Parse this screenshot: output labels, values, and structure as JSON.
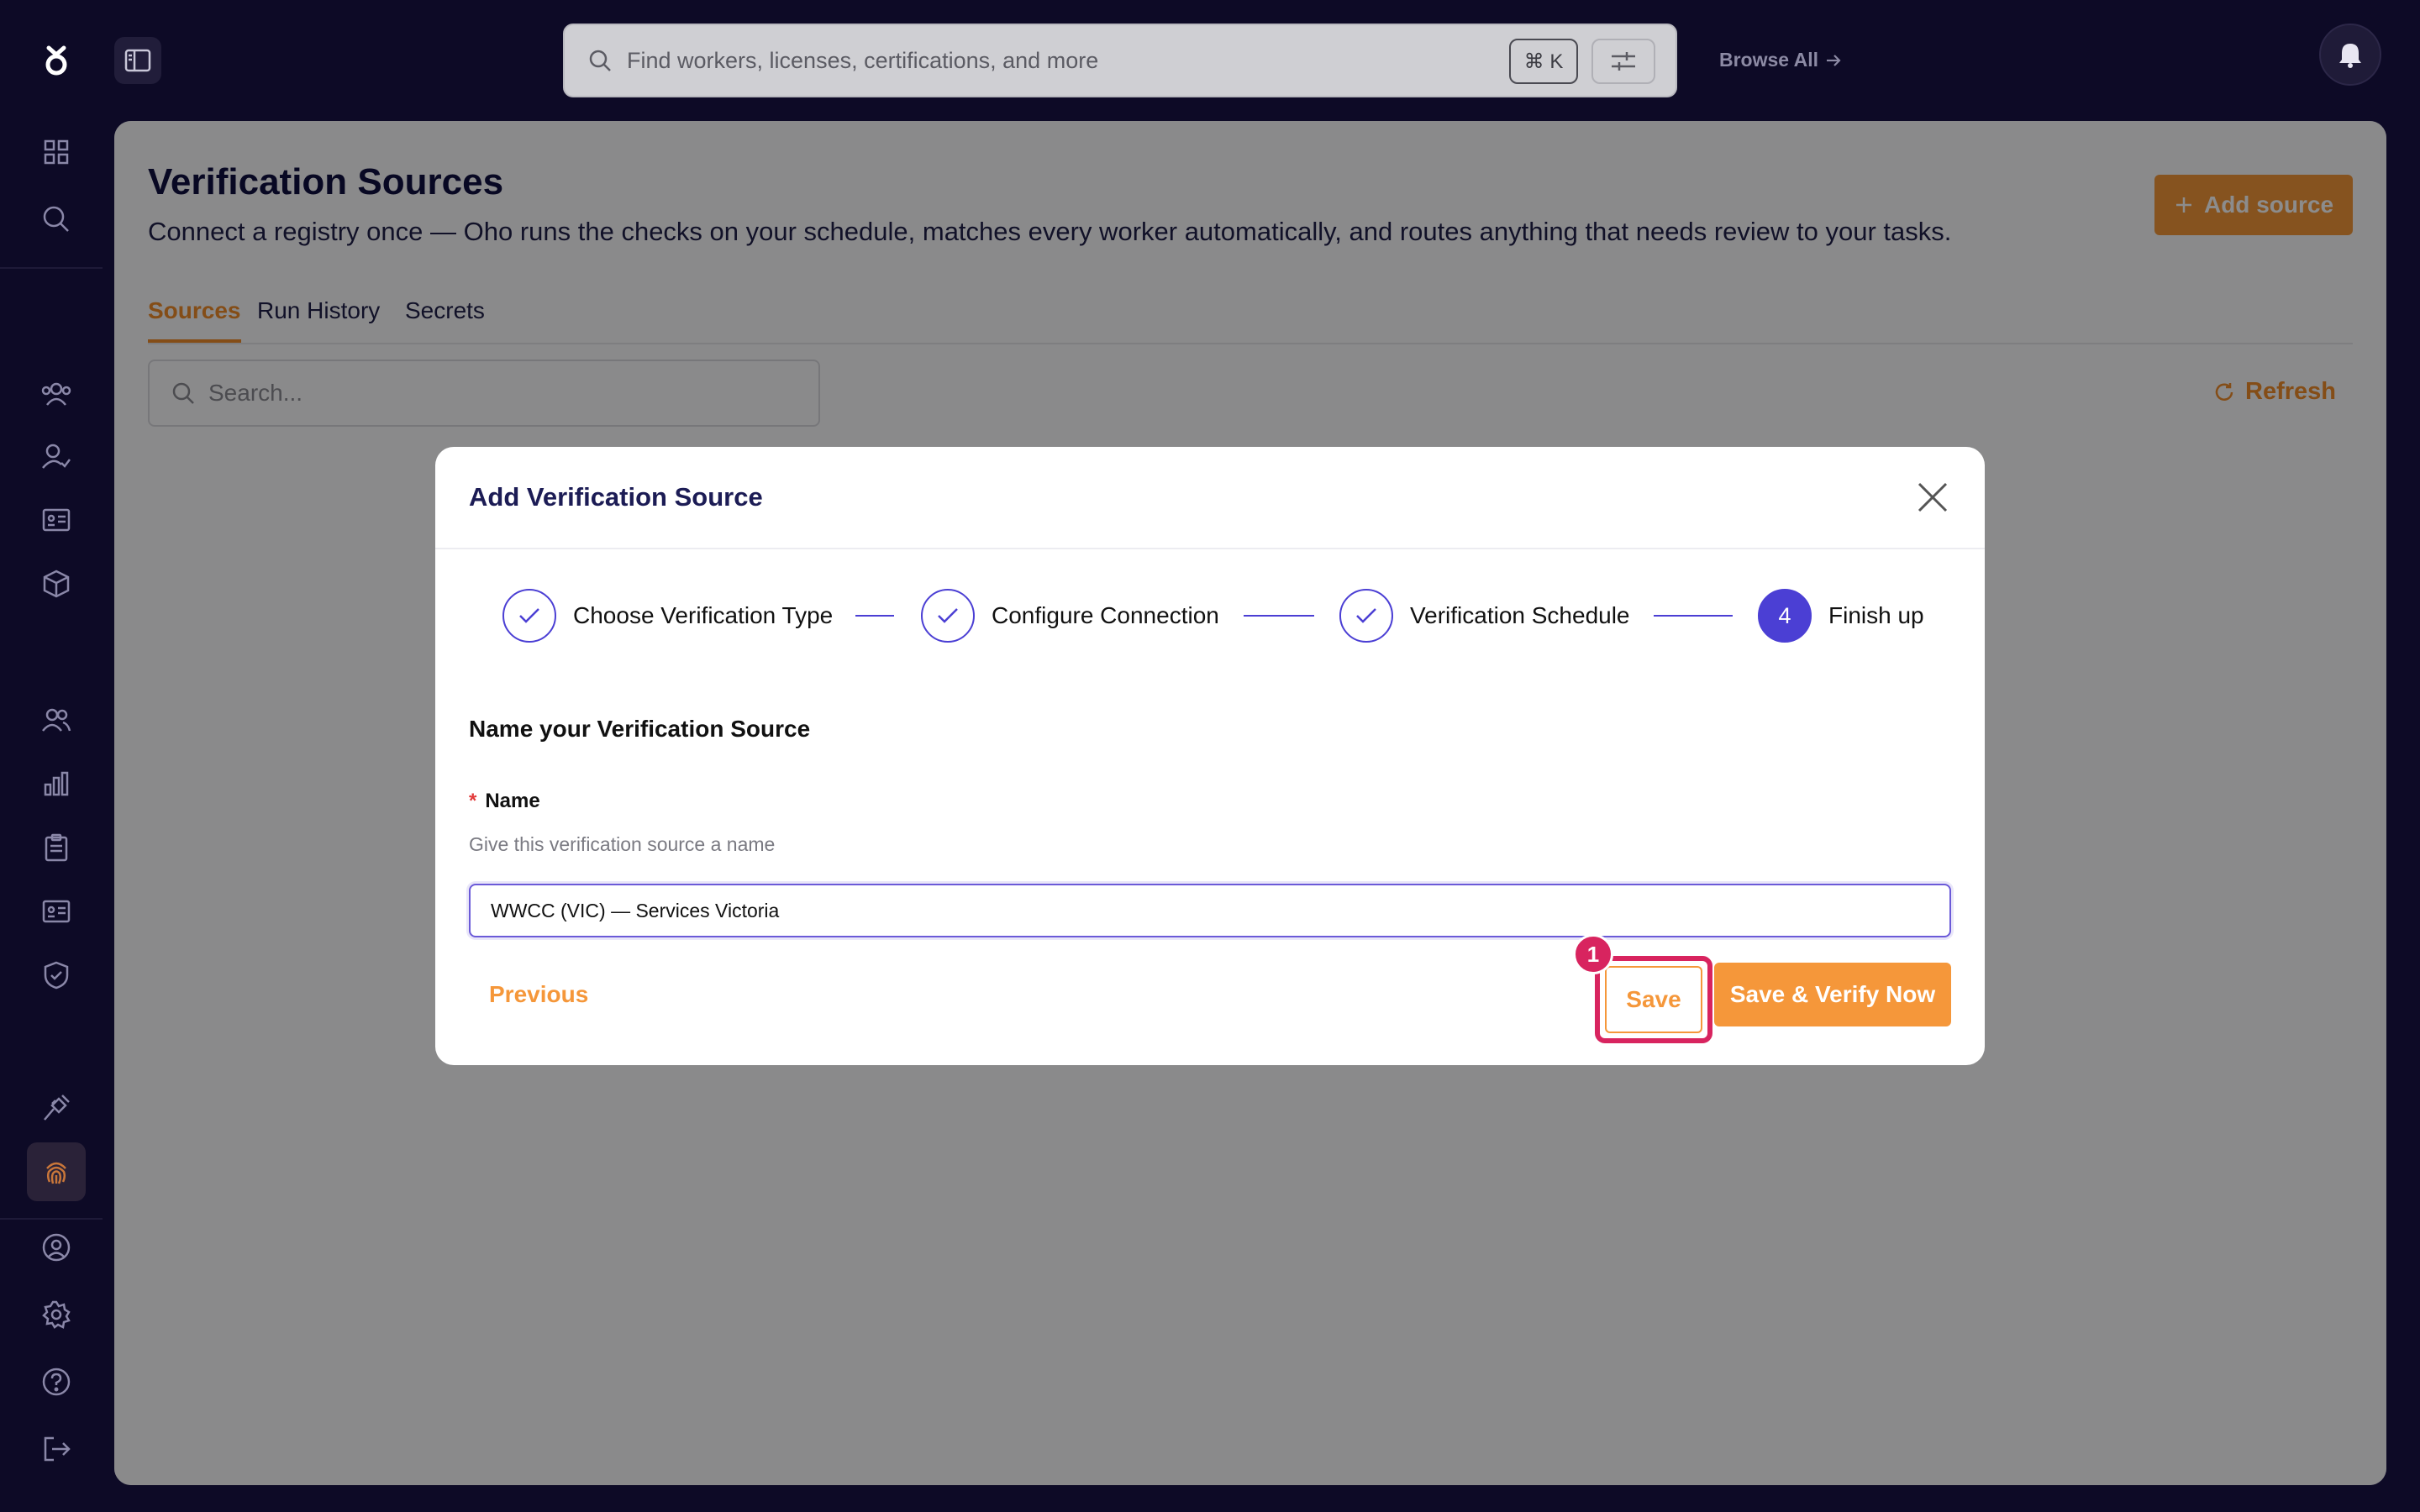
{
  "topbar": {
    "search_placeholder": "Find workers, licenses, certifications, and more",
    "shortcut": "⌘ K",
    "browse_all": "Browse All"
  },
  "rail": {
    "icons": [
      "logo-icon",
      "dashboard-icon",
      "search-icon",
      "team-icon",
      "user-check-icon",
      "id-card-icon",
      "package-icon",
      "users-icon",
      "bar-chart-icon",
      "clipboard-icon",
      "id-card-icon",
      "shield-check-icon",
      "plug-icon",
      "fingerprint-icon",
      "account-icon",
      "settings-icon",
      "help-icon",
      "logout-icon"
    ]
  },
  "page": {
    "title": "Verification Sources",
    "subtitle": "Connect a registry once — Oho runs the checks on your schedule, matches every worker automatically, and routes anything that needs review to your tasks.",
    "add_source": "Add source",
    "tabs": [
      "Sources",
      "Run History",
      "Secrets"
    ],
    "active_tab": "Sources",
    "search_placeholder": "Search...",
    "refresh": "Refresh"
  },
  "modal": {
    "title": "Add Verification Source",
    "steps": [
      {
        "label": "Choose Verification Type",
        "status": "complete"
      },
      {
        "label": "Configure Connection",
        "status": "complete"
      },
      {
        "label": "Verification Schedule",
        "status": "complete"
      },
      {
        "label": "Finish up",
        "status": "current",
        "number": "4"
      }
    ],
    "section_title": "Name your Verification Source",
    "field": {
      "required_mark": "*",
      "label": "Name",
      "help": "Give this verification source a name",
      "value": "WWCC (VIC) — Services Victoria"
    },
    "previous": "Previous",
    "save": "Save",
    "save_verify": "Save & Verify Now",
    "highlight_badge": "1"
  },
  "colors": {
    "accent_orange": "#f5973a",
    "step_purple": "#4b3fd4",
    "highlight": "#d8245f",
    "background": "#0d0a26"
  }
}
